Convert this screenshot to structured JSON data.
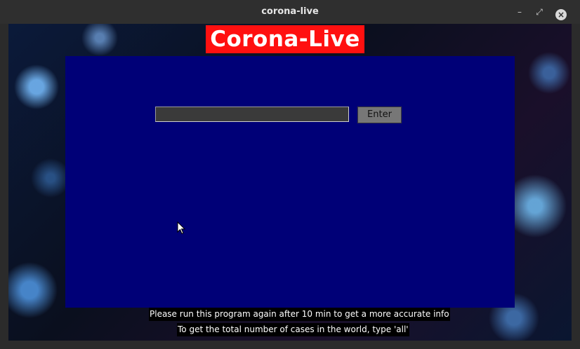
{
  "window": {
    "title": "corona-live",
    "controls": {
      "minimize": "–",
      "maximize": "⤢",
      "close": "×"
    }
  },
  "app": {
    "heading": "Corona-Live",
    "search": {
      "value": "",
      "placeholder": ""
    },
    "enter_label": "Enter",
    "info_lines": [
      "Please run this program again after 10 min to get a more accurate info",
      "To get the total number of cases in the world, type 'all'"
    ]
  },
  "colors": {
    "heading_bg": "#ff1010",
    "panel_bg": "#000077",
    "button_bg": "#777777"
  }
}
